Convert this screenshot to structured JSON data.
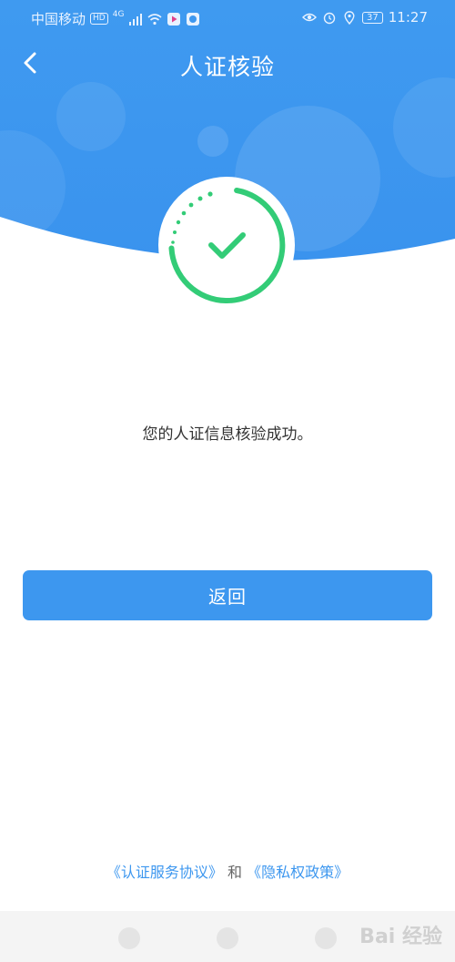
{
  "status_bar": {
    "carrier": "中国移动",
    "hd_badge": "HD",
    "network": "4G",
    "battery": "37",
    "time": "11:27",
    "icons": [
      "signal-icon",
      "wifi-icon",
      "video-app-icon",
      "baby-app-icon",
      "eye-icon",
      "alarm-icon",
      "location-icon",
      "battery-icon"
    ]
  },
  "nav": {
    "title": "人证核验",
    "back_icon": "chevron-left-icon"
  },
  "result": {
    "icon": "check-circle-icon",
    "status_color": "#33cc77",
    "message": "您的人证信息核验成功。"
  },
  "actions": {
    "return_label": "返回"
  },
  "footer": {
    "service_agreement": "《认证服务协议》",
    "conjunction": "和",
    "privacy_policy": "《隐私权政策》"
  },
  "watermark": {
    "text": "Bai 经验"
  },
  "colors": {
    "header_blue": "#3d97ef",
    "accent_blue": "#3d97ef",
    "success_green": "#33cc77"
  }
}
